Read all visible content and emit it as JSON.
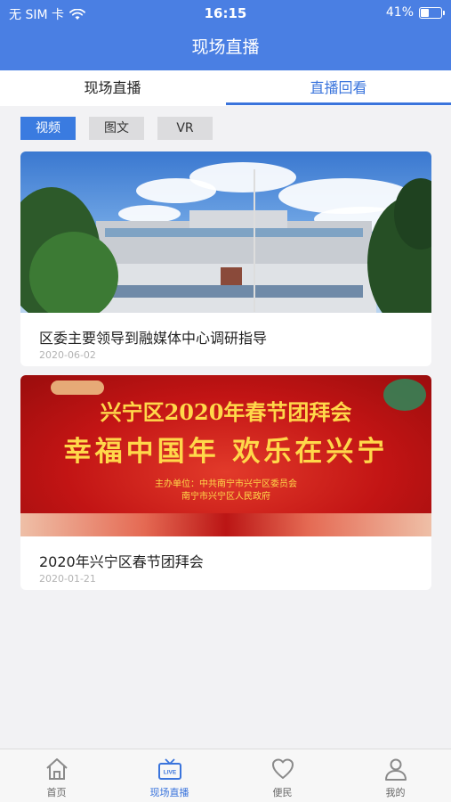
{
  "status_bar": {
    "carrier": "无 SIM 卡",
    "time": "16:15",
    "battery": "41%",
    "battery_level": 0.41
  },
  "header": {
    "title": "现场直播"
  },
  "tabs": [
    {
      "label": "现场直播",
      "active": false
    },
    {
      "label": "直播回看",
      "active": true
    }
  ],
  "filters": [
    {
      "label": "视频",
      "active": true
    },
    {
      "label": "图文",
      "active": false
    },
    {
      "label": "VR",
      "active": false
    }
  ],
  "cards": [
    {
      "title": "区委主要领导到融媒体中心调研指导",
      "date": "2020-06-02",
      "image": "government-building-photo"
    },
    {
      "title": "2020年兴宁区春节团拜会",
      "date": "2020-01-21",
      "image": "spring-festival-banner",
      "banner": {
        "line1": "兴宁区2020年春节团拜会",
        "line2": "幸福中国年  欢乐在兴宁",
        "line3": "主办单位：中共南宁市兴宁区委员会",
        "line4": "南宁市兴宁区人民政府"
      }
    }
  ],
  "bottom_nav": [
    {
      "label": "首页",
      "icon": "home-icon",
      "active": false
    },
    {
      "label": "现场直播",
      "icon": "live-tv-icon",
      "active": true
    },
    {
      "label": "便民",
      "icon": "heart-icon",
      "active": false
    },
    {
      "label": "我的",
      "icon": "user-icon",
      "active": false
    }
  ],
  "colors": {
    "primary": "#4a7fe3",
    "accent": "#3a74dc",
    "background": "#f2f2f4"
  }
}
